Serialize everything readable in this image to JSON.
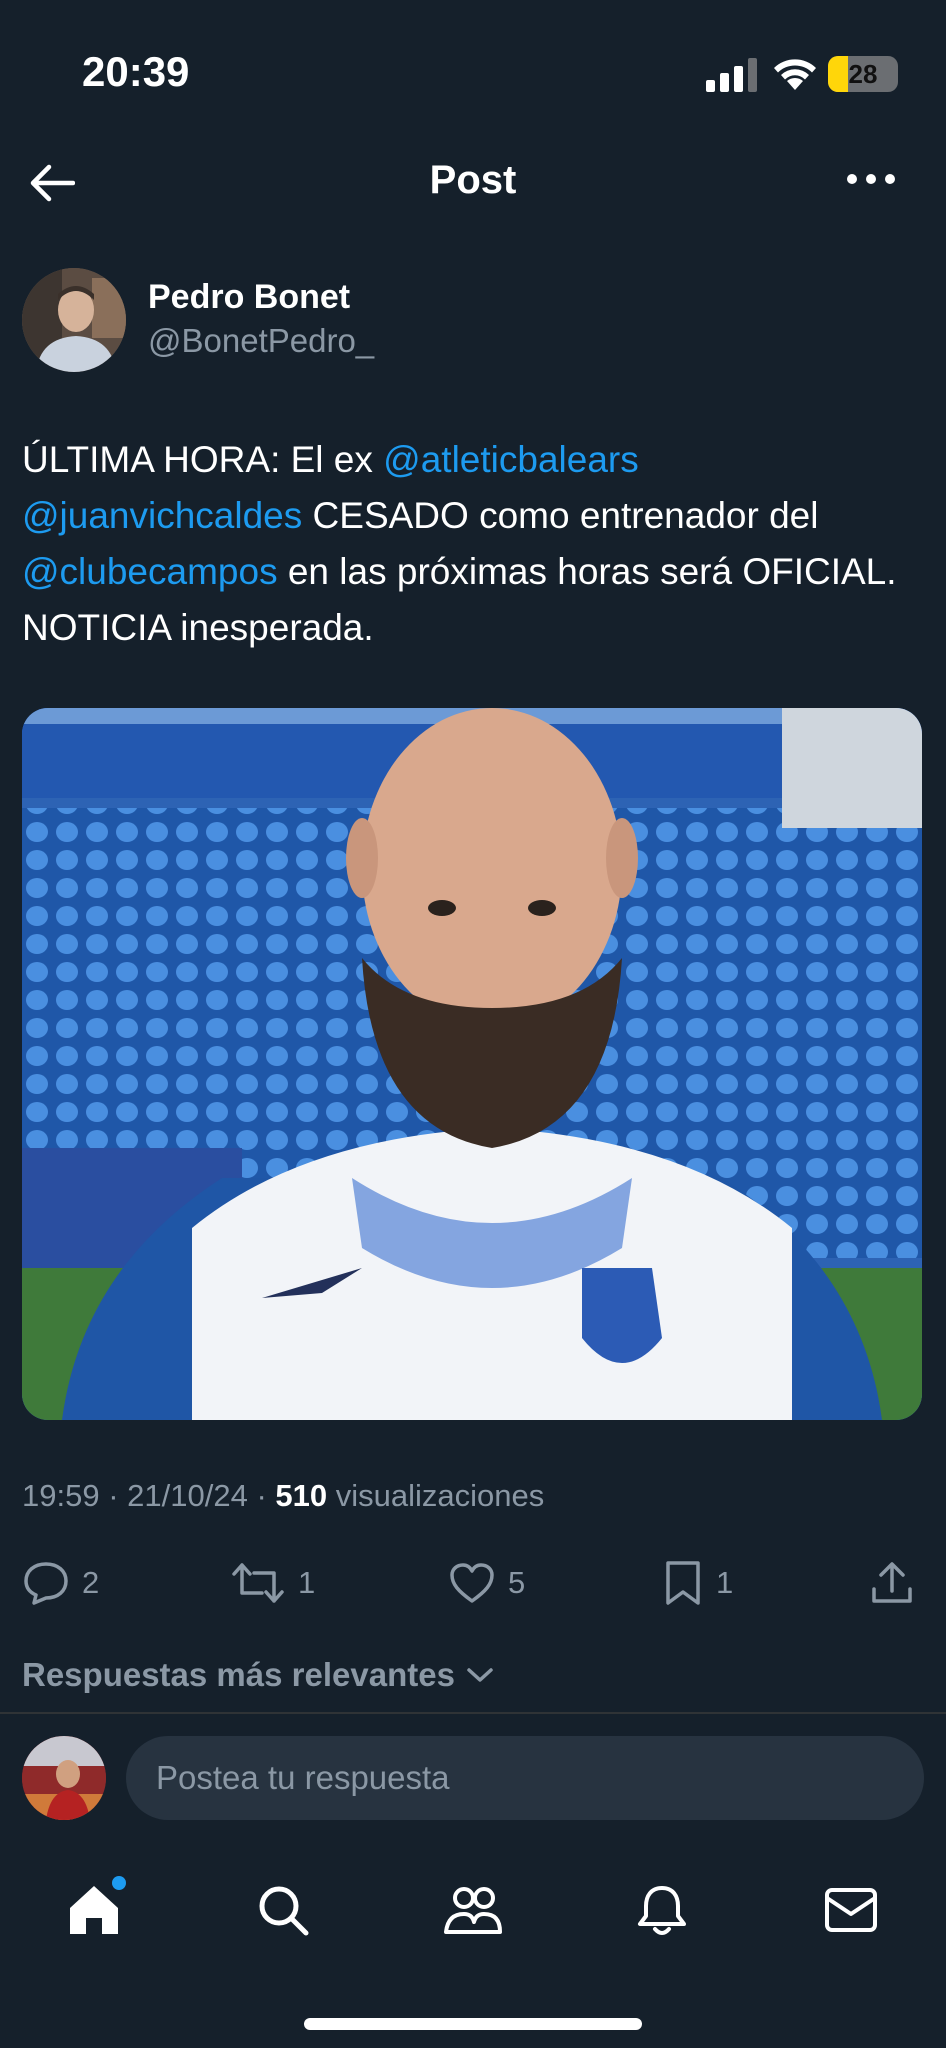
{
  "status_bar": {
    "time": "20:39",
    "battery": "28",
    "battery_level": 0.28
  },
  "header": {
    "title": "Post"
  },
  "author": {
    "name": "Pedro Bonet",
    "handle": "@BonetPedro_"
  },
  "tweet": {
    "parts": [
      {
        "text": "ÚLTIMA HORA: El ex ",
        "type": "text"
      },
      {
        "text": "@atleticbalears",
        "type": "mention"
      },
      {
        "text": " ",
        "type": "text"
      },
      {
        "text": "@juanvichcaldes",
        "type": "mention"
      },
      {
        "text": " CESADO como entrenador del ",
        "type": "text"
      },
      {
        "text": "@clubecampos",
        "type": "mention"
      },
      {
        "text": " en las próximas horas será OFICIAL. NOTICIA inesperada.",
        "type": "text"
      }
    ]
  },
  "meta": {
    "time": "19:59",
    "date": "21/10/24",
    "views_count": "510",
    "views_label": "visualizaciones",
    "sep": "·"
  },
  "actions": {
    "replies": "2",
    "reposts": "1",
    "likes": "5",
    "bookmarks": "1"
  },
  "replies_section": {
    "title": "Respuestas más relevantes"
  },
  "composer": {
    "placeholder": "Postea tu respuesta"
  },
  "nav": {
    "items": [
      "home",
      "search",
      "communities",
      "notifications",
      "messages"
    ]
  },
  "colors": {
    "background": "#15202b",
    "accent": "#1d9bf0",
    "muted": "#8b98a5",
    "battery": "#ffd60a"
  }
}
